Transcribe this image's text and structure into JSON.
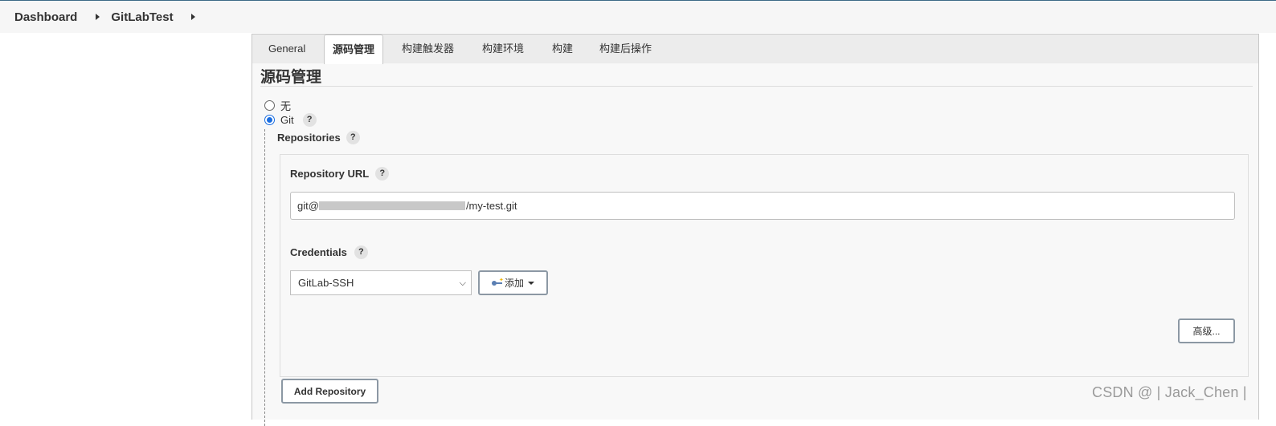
{
  "breadcrumb": {
    "items": [
      "Dashboard",
      "GitLabTest"
    ]
  },
  "tabs": [
    "General",
    "源码管理",
    "构建触发器",
    "构建环境",
    "构建",
    "构建后操作"
  ],
  "active_tab_index": 1,
  "section": {
    "title": "源码管理",
    "scm_options": [
      {
        "label": "无",
        "selected": false
      },
      {
        "label": "Git",
        "selected": true
      }
    ]
  },
  "help_glyph": "?",
  "repositories": {
    "label": "Repositories",
    "url_label": "Repository URL",
    "url_prefix": "git@",
    "url_suffix": "/my-test.git",
    "credentials_label": "Credentials",
    "credentials_selected": "GitLab-SSH",
    "add_label": "添加",
    "advanced_label": "高级...",
    "add_repository_label": "Add Repository"
  },
  "watermark": "CSDN @ | Jack_Chen |"
}
